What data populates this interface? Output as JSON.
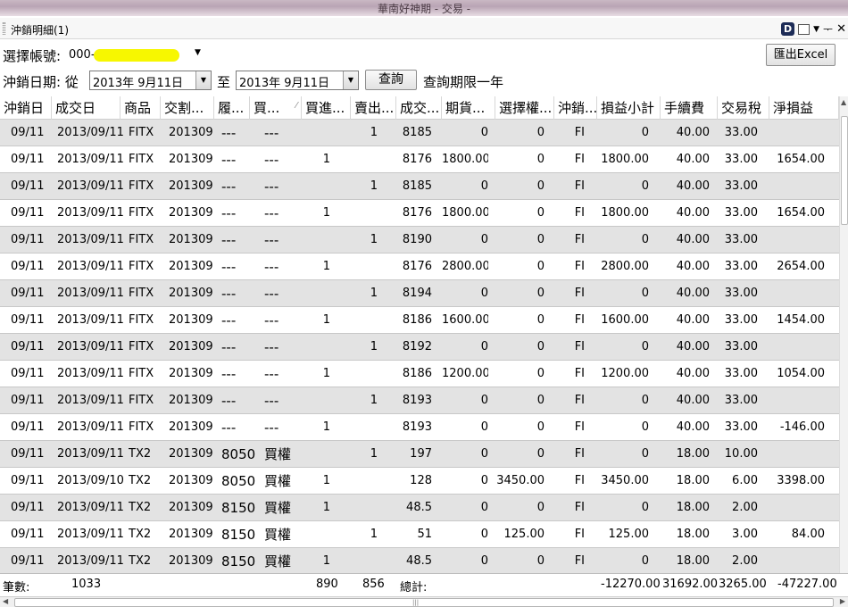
{
  "window": {
    "title": "華南好神期 - 交易 -"
  },
  "panel": {
    "title": "沖銷明細(1)"
  },
  "account": {
    "label": "選擇帳號:",
    "value": "000-"
  },
  "export_button": "匯出Excel",
  "date_filter": {
    "label": "沖銷日期: 從",
    "from": "2013年  9月11日",
    "to_label": "至",
    "to": "2013年  9月11日",
    "query_button": "查詢",
    "note": "查詢期限一年"
  },
  "columns": [
    "沖銷日",
    "成交日",
    "商品",
    "交割...",
    "履...",
    "買...",
    "買進...",
    "賣出...",
    "成交...",
    "期貨...",
    "選擇權...",
    "沖銷...",
    "損益小計",
    "手續費",
    "交易稅",
    "淨損益"
  ],
  "rows": [
    [
      "09/11",
      "2013/09/11",
      "FITX",
      "201309",
      "---",
      "---",
      "",
      "1",
      "8185",
      "0",
      "0",
      "FI",
      "0",
      "40.00",
      "33.00",
      ""
    ],
    [
      "09/11",
      "2013/09/11",
      "FITX",
      "201309",
      "---",
      "---",
      "1",
      "",
      "8176",
      "1800.00",
      "0",
      "FI",
      "1800.00",
      "40.00",
      "33.00",
      "1654.00"
    ],
    [
      "09/11",
      "2013/09/11",
      "FITX",
      "201309",
      "---",
      "---",
      "",
      "1",
      "8185",
      "0",
      "0",
      "FI",
      "0",
      "40.00",
      "33.00",
      ""
    ],
    [
      "09/11",
      "2013/09/11",
      "FITX",
      "201309",
      "---",
      "---",
      "1",
      "",
      "8176",
      "1800.00",
      "0",
      "FI",
      "1800.00",
      "40.00",
      "33.00",
      "1654.00"
    ],
    [
      "09/11",
      "2013/09/11",
      "FITX",
      "201309",
      "---",
      "---",
      "",
      "1",
      "8190",
      "0",
      "0",
      "FI",
      "0",
      "40.00",
      "33.00",
      ""
    ],
    [
      "09/11",
      "2013/09/11",
      "FITX",
      "201309",
      "---",
      "---",
      "1",
      "",
      "8176",
      "2800.00",
      "0",
      "FI",
      "2800.00",
      "40.00",
      "33.00",
      "2654.00"
    ],
    [
      "09/11",
      "2013/09/11",
      "FITX",
      "201309",
      "---",
      "---",
      "",
      "1",
      "8194",
      "0",
      "0",
      "FI",
      "0",
      "40.00",
      "33.00",
      ""
    ],
    [
      "09/11",
      "2013/09/11",
      "FITX",
      "201309",
      "---",
      "---",
      "1",
      "",
      "8186",
      "1600.00",
      "0",
      "FI",
      "1600.00",
      "40.00",
      "33.00",
      "1454.00"
    ],
    [
      "09/11",
      "2013/09/11",
      "FITX",
      "201309",
      "---",
      "---",
      "",
      "1",
      "8192",
      "0",
      "0",
      "FI",
      "0",
      "40.00",
      "33.00",
      ""
    ],
    [
      "09/11",
      "2013/09/11",
      "FITX",
      "201309",
      "---",
      "---",
      "1",
      "",
      "8186",
      "1200.00",
      "0",
      "FI",
      "1200.00",
      "40.00",
      "33.00",
      "1054.00"
    ],
    [
      "09/11",
      "2013/09/11",
      "FITX",
      "201309",
      "---",
      "---",
      "",
      "1",
      "8193",
      "0",
      "0",
      "FI",
      "0",
      "40.00",
      "33.00",
      ""
    ],
    [
      "09/11",
      "2013/09/11",
      "FITX",
      "201309",
      "---",
      "---",
      "1",
      "",
      "8193",
      "0",
      "0",
      "FI",
      "0",
      "40.00",
      "33.00",
      "-146.00"
    ],
    [
      "09/11",
      "2013/09/11",
      "TX2",
      "201309",
      "8050",
      "買權",
      "",
      "1",
      "197",
      "0",
      "0",
      "FI",
      "0",
      "18.00",
      "10.00",
      ""
    ],
    [
      "09/11",
      "2013/09/10",
      "TX2",
      "201309",
      "8050",
      "買權",
      "1",
      "",
      "128",
      "0",
      "3450.00",
      "FI",
      "3450.00",
      "18.00",
      "6.00",
      "3398.00"
    ],
    [
      "09/11",
      "2013/09/11",
      "TX2",
      "201309",
      "8150",
      "買權",
      "1",
      "",
      "48.5",
      "0",
      "0",
      "FI",
      "0",
      "18.00",
      "2.00",
      ""
    ],
    [
      "09/11",
      "2013/09/11",
      "TX2",
      "201309",
      "8150",
      "買權",
      "",
      "1",
      "51",
      "0",
      "125.00",
      "FI",
      "125.00",
      "18.00",
      "3.00",
      "84.00"
    ],
    [
      "09/11",
      "2013/09/11",
      "TX2",
      "201309",
      "8150",
      "買權",
      "1",
      "",
      "48.5",
      "0",
      "0",
      "FI",
      "0",
      "18.00",
      "2.00",
      ""
    ]
  ],
  "summary": {
    "count_label": "筆數:",
    "count": "1033",
    "buy_total": "890",
    "sell_total": "856",
    "total_label": "總計:",
    "pnl_subtotal": "-12270.00",
    "fee_total": "31692.00",
    "tax_total": "3265.00",
    "net_total": "-47227.00"
  },
  "colors": {
    "odd_row": "#e3e3e3",
    "even_row": "#ffffff",
    "highlight": "#f7f700"
  }
}
